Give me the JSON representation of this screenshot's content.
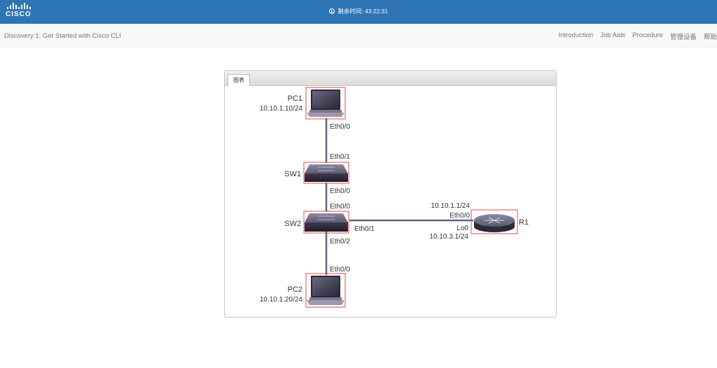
{
  "header": {
    "logo_text": "CISCO",
    "timer_label": "剩余时间:",
    "timer_value": "43:22:31"
  },
  "subheader": {
    "title": "Discovery 1: Get Started with Cisco CLI",
    "nav": [
      "Introduction",
      "Job Aids",
      "Procedure",
      "管理设备",
      "帮助"
    ]
  },
  "panel": {
    "tab_label": "图表"
  },
  "topology": {
    "devices": {
      "pc1": {
        "name": "PC1",
        "ip": "10.10.1.10/24"
      },
      "sw1": {
        "name": "SW1"
      },
      "sw2": {
        "name": "SW2"
      },
      "r1": {
        "name": "R1",
        "eth_ip": "10.10.1.1/24",
        "lo_ip": "10.10.3.1/24"
      },
      "pc2": {
        "name": "PC2",
        "ip": "10.10.1.20/24"
      }
    },
    "ports": {
      "pc1_eth": "Eth0/0",
      "sw1_up": "Eth0/1",
      "sw1_down": "Eth0/0",
      "sw2_up": "Eth0/0",
      "sw2_right": "Eth0/1",
      "sw2_down": "Eth0/2",
      "r1_eth": "Eth0/0",
      "r1_lo": "Lo0",
      "pc2_eth": "Eth0/0"
    }
  },
  "colors": {
    "header_bg": "#2e75b6",
    "link_line": "#59657a",
    "device_highlight": "#e8474b"
  }
}
